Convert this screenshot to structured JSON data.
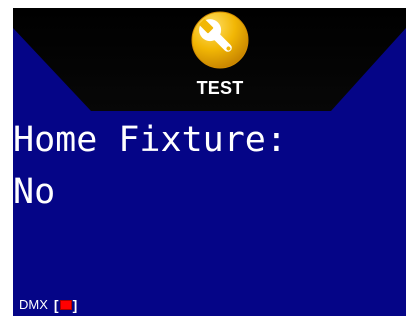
{
  "mode": {
    "icon": "wrench-icon",
    "label": "TEST"
  },
  "setting": {
    "name": "Home Fixture:",
    "value": "No"
  },
  "status": {
    "dmx_label": "DMX",
    "bracket_open": "[",
    "bracket_close": "]",
    "dmx_color": "#ff0000"
  },
  "colors": {
    "background": "#050587",
    "header": "#000000",
    "icon": "#f2b705"
  }
}
